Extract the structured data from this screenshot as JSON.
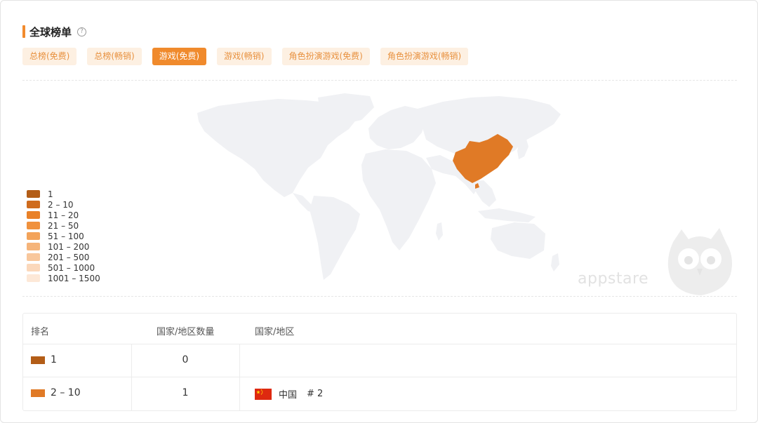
{
  "section": {
    "title": "全球榜单",
    "help_icon": "question-circle-icon"
  },
  "tabs": [
    {
      "label": "总榜(免费)",
      "active": false
    },
    {
      "label": "总榜(畅销)",
      "active": false
    },
    {
      "label": "游戏(免费)",
      "active": true
    },
    {
      "label": "游戏(畅销)",
      "active": false
    },
    {
      "label": "角色扮演游戏(免费)",
      "active": false
    },
    {
      "label": "角色扮演游戏(畅销)",
      "active": false
    }
  ],
  "colors": {
    "accent": "#f08a2c",
    "highlighted_region": "#e07a26",
    "land": "#f0f1f4",
    "legend": [
      "#b35d17",
      "#cf6b1d",
      "#e98128",
      "#f0913d",
      "#f3a35a",
      "#f5b47a",
      "#f8c79c",
      "#fbd8bb",
      "#fde8d7"
    ]
  },
  "map": {
    "highlighted_country": "China",
    "watermark": "appstare"
  },
  "legend": [
    "1",
    "2 – 10",
    "11 – 20",
    "21 – 50",
    "51 – 100",
    "101 – 200",
    "201 – 500",
    "501 – 1000",
    "1001 – 1500"
  ],
  "table": {
    "headers": {
      "rank": "排名",
      "count": "国家/地区数量",
      "countries": "国家/地区"
    },
    "rows": [
      {
        "rank": "1",
        "color": "#b35d17",
        "count": "0",
        "countries": []
      },
      {
        "rank": "2 – 10",
        "color": "#e07a26",
        "count": "1",
        "countries": [
          {
            "name": "中国",
            "rank": "# 2",
            "flag_icon": "china-flag-icon"
          }
        ]
      }
    ]
  }
}
